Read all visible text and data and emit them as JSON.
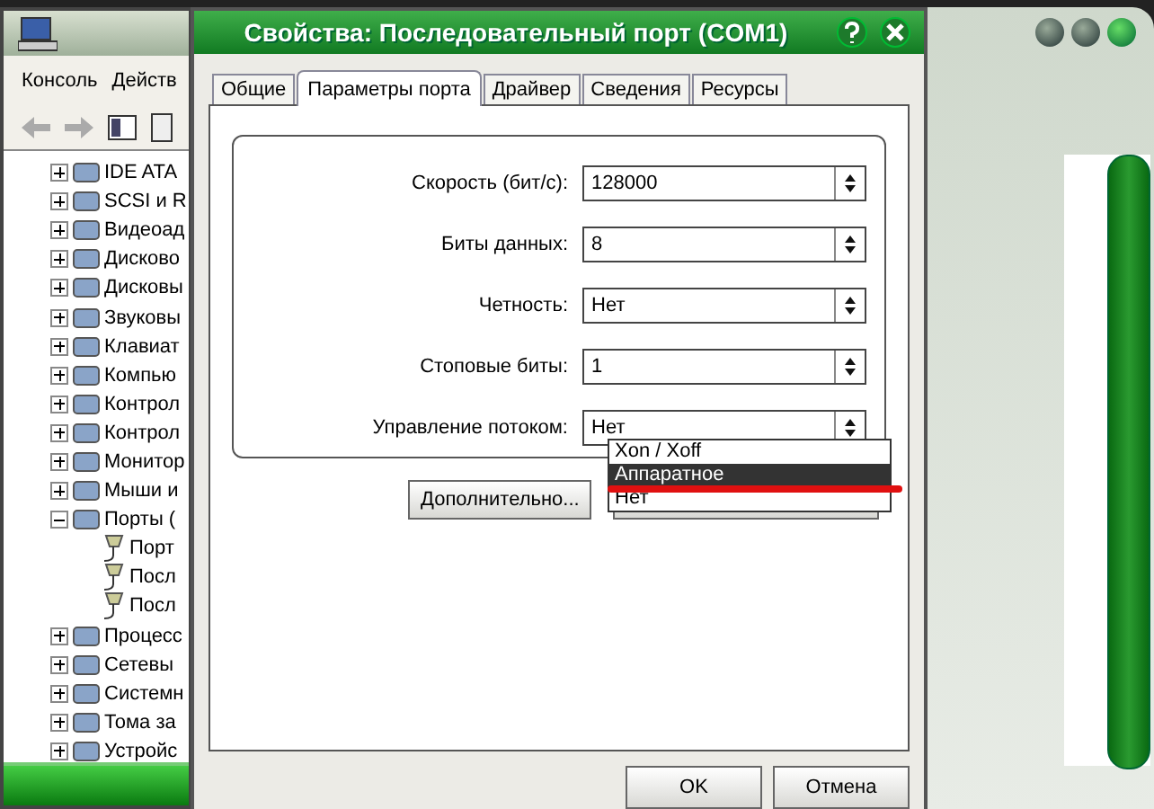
{
  "background_window": {
    "menu": [
      "Консоль",
      "Действ"
    ],
    "tree": [
      {
        "label": "IDE ATA",
        "expanded": false
      },
      {
        "label": "SCSI и R",
        "expanded": false
      },
      {
        "label": "Видеоад",
        "expanded": false
      },
      {
        "label": "Дисково",
        "expanded": false
      },
      {
        "label": "Дисковы",
        "expanded": false
      },
      {
        "label": "Звуковы",
        "expanded": false
      },
      {
        "label": "Клавиат",
        "expanded": false
      },
      {
        "label": "Компью",
        "expanded": false
      },
      {
        "label": "Контрол",
        "expanded": false
      },
      {
        "label": "Контрол",
        "expanded": false
      },
      {
        "label": "Монитор",
        "expanded": false
      },
      {
        "label": "Мыши и",
        "expanded": false
      },
      {
        "label": "Порты (",
        "expanded": true,
        "children": [
          {
            "label": "Порт"
          },
          {
            "label": "Посл"
          },
          {
            "label": "Посл"
          }
        ]
      },
      {
        "label": "Процесс",
        "expanded": false
      },
      {
        "label": "Сетевы",
        "expanded": false
      },
      {
        "label": "Системн",
        "expanded": false
      },
      {
        "label": "Тома за",
        "expanded": false
      },
      {
        "label": "Устройс",
        "expanded": false
      }
    ]
  },
  "dialog": {
    "title": "Свойства: Последовательный порт (COM1)",
    "tabs": [
      {
        "label": "Общие",
        "selected": false
      },
      {
        "label": "Параметры порта",
        "selected": true
      },
      {
        "label": "Драйвер",
        "selected": false
      },
      {
        "label": "Сведения",
        "selected": false
      },
      {
        "label": "Ресурсы",
        "selected": false
      }
    ],
    "fields": [
      {
        "label": "Скорость (бит/с):",
        "value": "128000"
      },
      {
        "label": "Биты данных:",
        "value": "8"
      },
      {
        "label": "Четность:",
        "value": "Нет"
      },
      {
        "label": "Стоповые биты:",
        "value": "1"
      },
      {
        "label": "Управление потоком:",
        "value": "Нет"
      }
    ],
    "dropdown": [
      {
        "label": "Xon / Xoff",
        "selected": false
      },
      {
        "label": "Аппаратное",
        "selected": true
      },
      {
        "label": "Нет",
        "selected": false
      }
    ],
    "advanced_button": "Дополнительно...",
    "buttons": [
      "OK",
      "Отмена"
    ]
  }
}
